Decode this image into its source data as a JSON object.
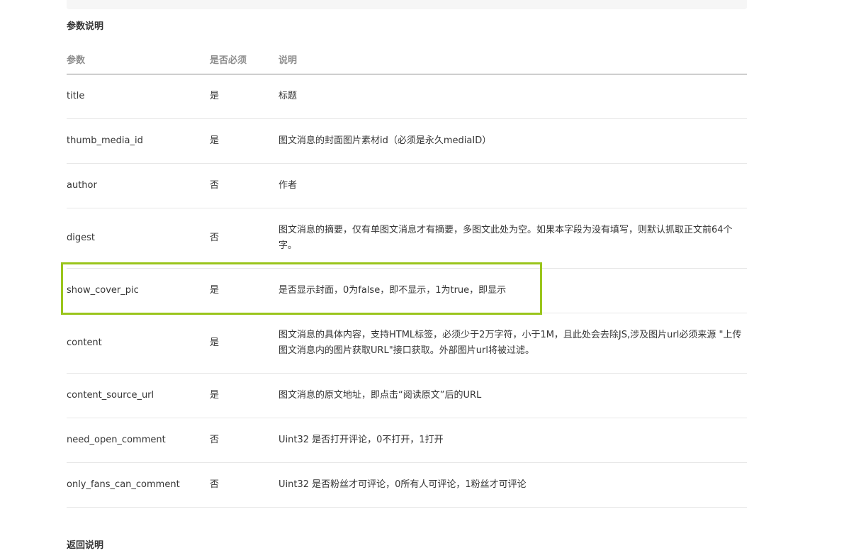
{
  "section_params_title": "参数说明",
  "section_return_title": "返回说明",
  "table": {
    "headers": {
      "param": "参数",
      "required": "是否必须",
      "description": "说明"
    },
    "rows": [
      {
        "param": "title",
        "required": "是",
        "description": "标题"
      },
      {
        "param": "thumb_media_id",
        "required": "是",
        "description": "图文消息的封面图片素材id（必须是永久mediaID）"
      },
      {
        "param": "author",
        "required": "否",
        "description": "作者"
      },
      {
        "param": "digest",
        "required": "否",
        "description": "图文消息的摘要，仅有单图文消息才有摘要，多图文此处为空。如果本字段为没有填写，则默认抓取正文前64个字。"
      },
      {
        "param": "show_cover_pic",
        "required": "是",
        "description": "是否显示封面，0为false，即不显示，1为true，即显示"
      },
      {
        "param": "content",
        "required": "是",
        "description": "图文消息的具体内容，支持HTML标签，必须少于2万字符，小于1M，且此处会去除JS,涉及图片url必须来源 \"上传图文消息内的图片获取URL\"接口获取。外部图片url将被过滤。"
      },
      {
        "param": "content_source_url",
        "required": "是",
        "description": "图文消息的原文地址，即点击“阅读原文”后的URL"
      },
      {
        "param": "need_open_comment",
        "required": "否",
        "description": "Uint32 是否打开评论，0不打开，1打开"
      },
      {
        "param": "only_fans_can_comment",
        "required": "否",
        "description": "Uint32 是否粉丝才可评论，0所有人可评论，1粉丝才可评论"
      }
    ]
  },
  "highlight": {
    "color": "#9ac51c",
    "target_param": "show_cover_pic"
  }
}
